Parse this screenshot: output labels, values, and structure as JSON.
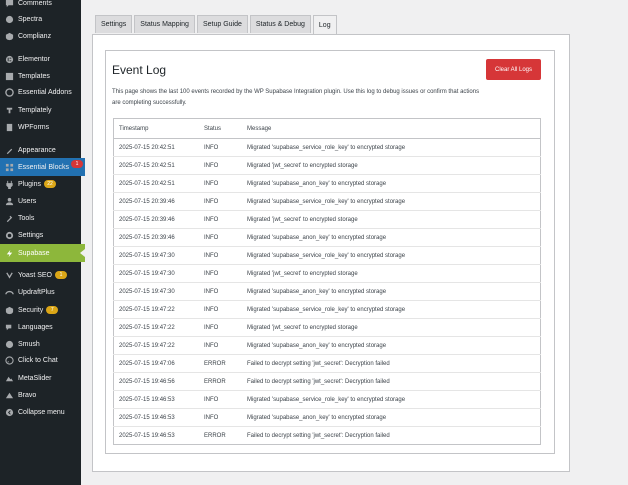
{
  "sidebar": {
    "items": [
      {
        "label": "Comments",
        "icon": "comment-icon"
      },
      {
        "label": "Spectra",
        "icon": "spectra-icon"
      },
      {
        "label": "Complianz",
        "icon": "complianz-icon"
      },
      {
        "label": "Elementor",
        "icon": "elementor-icon"
      },
      {
        "label": "Templates",
        "icon": "templates-icon"
      },
      {
        "label": "Essential Addons",
        "icon": "essential-addons-icon"
      },
      {
        "label": "Templately",
        "icon": "templately-icon"
      },
      {
        "label": "WPForms",
        "icon": "wpforms-icon"
      },
      {
        "label": "Appearance",
        "icon": "appearance-icon"
      },
      {
        "label": "Essential Blocks",
        "icon": "essential-blocks-icon",
        "badge": "1"
      },
      {
        "label": "Plugins",
        "icon": "plugins-icon",
        "badge": "22"
      },
      {
        "label": "Users",
        "icon": "users-icon"
      },
      {
        "label": "Tools",
        "icon": "tools-icon"
      },
      {
        "label": "Settings",
        "icon": "settings-icon"
      },
      {
        "label": "Supabase",
        "icon": "supabase-icon"
      },
      {
        "label": "Yoast SEO",
        "icon": "yoast-icon",
        "badge": "1"
      },
      {
        "label": "UpdraftPlus",
        "icon": "updraftplus-icon"
      },
      {
        "label": "Security",
        "icon": "security-icon",
        "badge": "7"
      },
      {
        "label": "Languages",
        "icon": "languages-icon"
      },
      {
        "label": "Smush",
        "icon": "smush-icon"
      },
      {
        "label": "Click to Chat",
        "icon": "click-to-chat-icon"
      },
      {
        "label": "MetaSlider",
        "icon": "metaslider-icon"
      },
      {
        "label": "Bravo",
        "icon": "bravo-icon"
      },
      {
        "label": "Collapse menu",
        "icon": "collapse-icon"
      }
    ]
  },
  "tabs": [
    {
      "label": "Settings"
    },
    {
      "label": "Status Mapping"
    },
    {
      "label": "Setup Guide"
    },
    {
      "label": "Status & Debug"
    },
    {
      "label": "Log"
    }
  ],
  "event_log": {
    "title": "Event Log",
    "clear_label": "Clear All Logs",
    "description": "This page shows the last 100 events recorded by the WP Supabase Integration plugin. Use this log to debug issues or confirm that actions are completing successfully.",
    "columns": [
      "Timestamp",
      "Status",
      "Message"
    ],
    "rows": [
      {
        "time": "2025-07-15 20:42:51",
        "status": "INFO",
        "message": "Migrated 'supabase_service_role_key' to encrypted storage"
      },
      {
        "time": "2025-07-15 20:42:51",
        "status": "INFO",
        "message": "Migrated 'jwt_secret' to encrypted storage"
      },
      {
        "time": "2025-07-15 20:42:51",
        "status": "INFO",
        "message": "Migrated 'supabase_anon_key' to encrypted storage"
      },
      {
        "time": "2025-07-15 20:39:46",
        "status": "INFO",
        "message": "Migrated 'supabase_service_role_key' to encrypted storage"
      },
      {
        "time": "2025-07-15 20:39:46",
        "status": "INFO",
        "message": "Migrated 'jwt_secret' to encrypted storage"
      },
      {
        "time": "2025-07-15 20:39:46",
        "status": "INFO",
        "message": "Migrated 'supabase_anon_key' to encrypted storage"
      },
      {
        "time": "2025-07-15 19:47:30",
        "status": "INFO",
        "message": "Migrated 'supabase_service_role_key' to encrypted storage"
      },
      {
        "time": "2025-07-15 19:47:30",
        "status": "INFO",
        "message": "Migrated 'jwt_secret' to encrypted storage"
      },
      {
        "time": "2025-07-15 19:47:30",
        "status": "INFO",
        "message": "Migrated 'supabase_anon_key' to encrypted storage"
      },
      {
        "time": "2025-07-15 19:47:22",
        "status": "INFO",
        "message": "Migrated 'supabase_service_role_key' to encrypted storage"
      },
      {
        "time": "2025-07-15 19:47:22",
        "status": "INFO",
        "message": "Migrated 'jwt_secret' to encrypted storage"
      },
      {
        "time": "2025-07-15 19:47:22",
        "status": "INFO",
        "message": "Migrated 'supabase_anon_key' to encrypted storage"
      },
      {
        "time": "2025-07-15 19:47:06",
        "status": "ERROR",
        "message": "Failed to decrypt setting 'jwt_secret': Decryption failed"
      },
      {
        "time": "2025-07-15 19:46:56",
        "status": "ERROR",
        "message": "Failed to decrypt setting 'jwt_secret': Decryption failed"
      },
      {
        "time": "2025-07-15 19:46:53",
        "status": "INFO",
        "message": "Migrated 'supabase_service_role_key' to encrypted storage"
      },
      {
        "time": "2025-07-15 19:46:53",
        "status": "INFO",
        "message": "Migrated 'supabase_anon_key' to encrypted storage"
      },
      {
        "time": "2025-07-15 19:46:53",
        "status": "ERROR",
        "message": "Failed to decrypt setting 'jwt_secret': Decryption failed"
      }
    ]
  },
  "colors": {
    "sidebar_bg": "#1d2327",
    "active_menu": "#2271b1",
    "current_menu": "#8db73b",
    "error": "#d63638",
    "badge": "#dba617"
  }
}
